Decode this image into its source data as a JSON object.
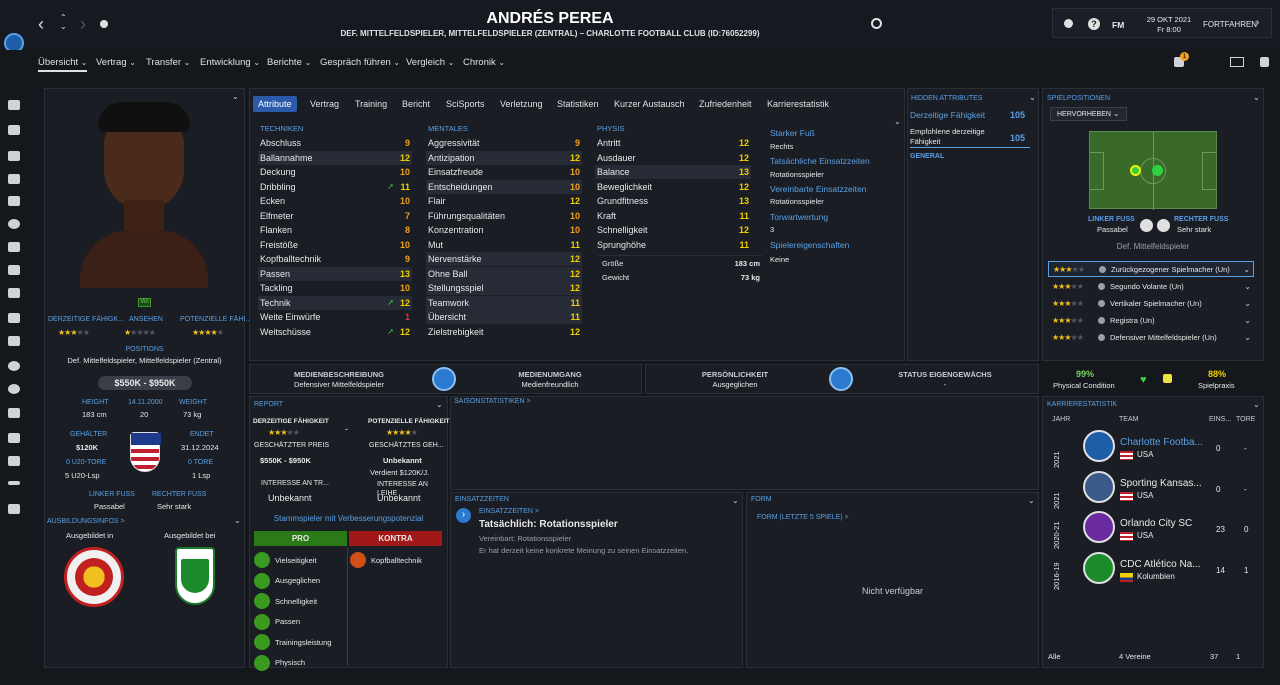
{
  "header": {
    "player_name": "ANDRÉS PEREA",
    "subtitle": "DEF. MITTELFELDSPIELER, MITTELFELDSPIELER (ZENTRAL) – CHARLOTTE FOOTBALL CLUB (ID:76052299)",
    "date": "29 OKT 2021",
    "time": "Fr 8:00",
    "fm_label": "FM",
    "continue_label": "FORTFAHREN",
    "notification_count": "1"
  },
  "nav": [
    "Übersicht",
    "Vertrag",
    "Transfer",
    "Entwicklung",
    "Berichte",
    "Gespräch führen",
    "Vergleich",
    "Chronik"
  ],
  "tabs": [
    "Attribute",
    "Vertrag",
    "Training",
    "Bericht",
    "SciSports",
    "Verletzung",
    "Statistiken",
    "Kurzer Austausch",
    "Zufriedenheit",
    "Karrierestatistik"
  ],
  "profile": {
    "badge": "Vin",
    "ca_label": "DERZEITIGE FÄHIGK...",
    "rep_label": "ANSEHEN",
    "pa_label": "POTENZIELLE FÄHI...",
    "positions_label": "POSITIONS",
    "positions": "Def. Mittelfeldspieler, Mittelfeldspieler (Zentral)",
    "value": "$550K - $950K",
    "height_label": "HEIGHT",
    "height": "183 cm",
    "dob": "14.11.2000",
    "age": "20",
    "weight_label": "WEIGHT",
    "weight": "73 kg",
    "wage_label": "GEHÄLTER",
    "wage": "$120K",
    "ends_label": "ENDET",
    "ends": "31.12.2024",
    "u20_goals_label": "0 U20-TORE",
    "u20_apps": "5 U20-Lsp",
    "goals_label": "0 TORE",
    "apps": "1 Lsp",
    "left_foot_label": "LINKER FUSS",
    "left_foot": "Passabel",
    "right_foot_label": "RECHTER FUSS",
    "right_foot": "Sehr stark",
    "training_label": "AUSBILDUNGSINFOS >",
    "trained_in_label": "Ausgebildet in",
    "trained_at_label": "Ausgebildet bei"
  },
  "technical": {
    "title": "TECHNIKEN",
    "rows": [
      {
        "name": "Abschluss",
        "val": "9"
      },
      {
        "name": "Ballannahme",
        "val": "12"
      },
      {
        "name": "Deckung",
        "val": "10"
      },
      {
        "name": "Dribbling",
        "val": "11"
      },
      {
        "name": "Ecken",
        "val": "10"
      },
      {
        "name": "Elfmeter",
        "val": "7"
      },
      {
        "name": "Flanken",
        "val": "8"
      },
      {
        "name": "Freistöße",
        "val": "10"
      },
      {
        "name": "Kopfballtechnik",
        "val": "9"
      },
      {
        "name": "Passen",
        "val": "13"
      },
      {
        "name": "Tackling",
        "val": "10"
      },
      {
        "name": "Technik",
        "val": "12"
      },
      {
        "name": "Weite Einwürfe",
        "val": "1"
      },
      {
        "name": "Weitschüsse",
        "val": "12"
      }
    ]
  },
  "mental": {
    "title": "MENTALES",
    "rows": [
      {
        "name": "Aggressivität",
        "val": "9"
      },
      {
        "name": "Antizipation",
        "val": "12"
      },
      {
        "name": "Einsatzfreude",
        "val": "10"
      },
      {
        "name": "Entscheidungen",
        "val": "10"
      },
      {
        "name": "Flair",
        "val": "12"
      },
      {
        "name": "Führungsqualitäten",
        "val": "10"
      },
      {
        "name": "Konzentration",
        "val": "10"
      },
      {
        "name": "Mut",
        "val": "11"
      },
      {
        "name": "Nervenstärke",
        "val": "12"
      },
      {
        "name": "Ohne Ball",
        "val": "12"
      },
      {
        "name": "Stellungsspiel",
        "val": "12"
      },
      {
        "name": "Teamwork",
        "val": "11"
      },
      {
        "name": "Übersicht",
        "val": "11"
      },
      {
        "name": "Zielstrebigkeit",
        "val": "12"
      }
    ]
  },
  "physical": {
    "title": "PHYSIS",
    "rows": [
      {
        "name": "Antritt",
        "val": "12"
      },
      {
        "name": "Ausdauer",
        "val": "12"
      },
      {
        "name": "Balance",
        "val": "13"
      },
      {
        "name": "Beweglichkeit",
        "val": "12"
      },
      {
        "name": "Grundfitness",
        "val": "13"
      },
      {
        "name": "Kraft",
        "val": "11"
      },
      {
        "name": "Schnelligkeit",
        "val": "12"
      },
      {
        "name": "Sprunghöhe",
        "val": "11"
      }
    ],
    "size_label": "Größe",
    "size": "183 cm",
    "weight_label": "Gewicht",
    "weight": "73 kg"
  },
  "info": {
    "foot_label": "Starker Fuß",
    "foot": "Rechts",
    "actual_label": "Tatsächliche Einsatzzeiten",
    "actual": "Rotationsspieler",
    "agreed_label": "Vereinbarte Einsatzzeiten",
    "agreed": "Rotationsspieler",
    "gk_label": "Torwartwertung",
    "gk": "3",
    "traits_label": "Spielereigenschaften",
    "traits": "Keine"
  },
  "hidden": {
    "title": "HIDDEN ATTRIBUTES",
    "ca_label": "Derzeitige Fähigkeit",
    "ca": "105",
    "rec_label": "Empfohlene derzeitige Fähigkeit",
    "rec": "105",
    "general": "GENERAL"
  },
  "positions_panel": {
    "title": "SPIELPOSITIONEN",
    "dropdown": "HERVORHEBEN",
    "left_foot_label": "LINKER FUSS",
    "left_foot": "Passabel",
    "right_foot_label": "RECHTER FUSS",
    "right_foot": "Sehr stark",
    "position": "Def. Mittelfeldspieler",
    "roles": [
      "Zurückgezogener Spielmacher (Un)",
      "Segundo Volante (Un)",
      "Vertikaler Spielmacher (Un)",
      "Registra (Un)",
      "Defensiver Mittelfeldspieler (Un)"
    ],
    "condition": "99%",
    "condition_label": "Physical Condition",
    "practice": "88%",
    "practice_label": "Spielpraxis"
  },
  "media": {
    "desc_label": "MEDIENBESCHREIBUNG",
    "desc": "Defensiver Mittelfeldspieler",
    "handling_label": "MEDIENUMGANG",
    "handling": "Medienfreundlich",
    "personality_label": "PERSÖNLICHKEIT",
    "personality": "Ausgeglichen",
    "homegrown_label": "STATUS EIGENGEWÄCHS",
    "homegrown": "-"
  },
  "report": {
    "title": "REPORT",
    "ca_label": "DERZEITIGE FÄHIGKEIT",
    "pa_label": "POTENZIELLE FÄHIGKEIT",
    "dash": "-",
    "est_price_label": "GESCHÄTZTER PREIS",
    "est_price": "$550K - $950K",
    "est_wage_label": "GESCHÄTZTES GEH...",
    "est_wage": "Unbekannt",
    "earned": "Verdient $120K/J.",
    "interest_tr_label": "INTERESSE AN TR...",
    "interest_tr": "Unbekannt",
    "interest_loan_label": "INTERESSE AN LEIHE",
    "interest_loan": "Unbekannt",
    "summary": "Stammspieler mit Verbesserungspotenzial",
    "pro": "PRO",
    "contra": "KONTRA",
    "pros": [
      "Vielseitigkeit",
      "Ausgeglichen",
      "Schnelligkeit",
      "Passen",
      "Trainingsleistung",
      "Physisch"
    ],
    "cons": [
      "Kopfballtechnik"
    ]
  },
  "season": {
    "title": "SAISONSTATISTIKEN >"
  },
  "playtime": {
    "title": "EINSATZZEITEN",
    "link": "EINSATZZEITEN >",
    "headline": "Tatsächlich: Rotationsspieler",
    "agreed": "Vereinbart: Rotationsspieler",
    "note": "Er hat derzeit keine konkrete Meinung zu seinen Einsatzzeiten."
  },
  "form": {
    "title": "FORM",
    "link": "FORM (LETZTE 5 SPIELE) >",
    "empty": "Nicht verfügbar"
  },
  "career": {
    "title": "KARRIERESTATISTIK",
    "col_year": "JAHR",
    "col_team": "TEAM",
    "col_apps": "EINS...",
    "col_goals": "TORE",
    "rows": [
      {
        "year": "2021",
        "team": "Charlotte Footba...",
        "country": "USA",
        "apps": "0",
        "goals": "-"
      },
      {
        "year": "2021",
        "team": "Sporting Kansas...",
        "country": "USA",
        "apps": "0",
        "goals": "-"
      },
      {
        "year": "2020-21",
        "team": "Orlando City SC",
        "country": "USA",
        "apps": "23",
        "goals": "0"
      },
      {
        "year": "2016-19",
        "team": "CDC Atlético Na...",
        "country": "Kolumbien",
        "apps": "14",
        "goals": "1"
      }
    ],
    "total_label": "Alle",
    "total_clubs": "4 Vereine",
    "total_apps": "37",
    "total_goals": "1"
  },
  "colors": {
    "accent": "#2b5aa8",
    "link": "#5aa0e6",
    "pro": "#3a9a20",
    "contra": "#c02020"
  }
}
